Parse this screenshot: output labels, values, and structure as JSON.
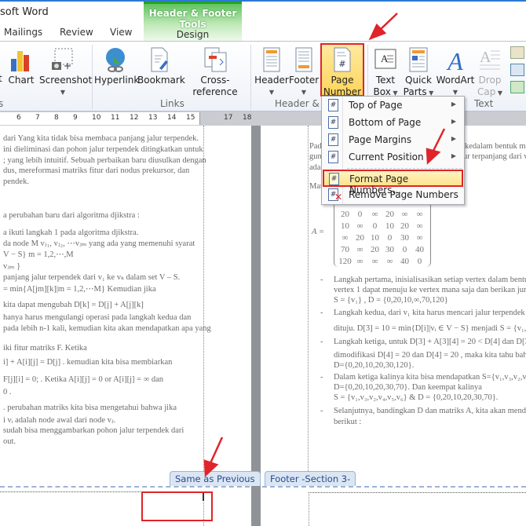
{
  "window": {
    "title": "soft Word"
  },
  "contextual_tab": {
    "group_label": "Header & Footer Tools",
    "tab": "Design",
    "color": "#5fc35f"
  },
  "tabs": [
    "Mailings",
    "Review",
    "View"
  ],
  "ribbon": {
    "buttons": [
      {
        "label": "Chart"
      },
      {
        "label": "Screenshot"
      },
      {
        "label": "Hyperlink"
      },
      {
        "label": "Bookmark"
      },
      {
        "label": "Cross-reference"
      },
      {
        "label": "Header"
      },
      {
        "label": "Footer"
      },
      {
        "label": "Page",
        "label2": "Number"
      },
      {
        "label": "Text",
        "label2": "Box"
      },
      {
        "label": "Quick",
        "label2": "Parts"
      },
      {
        "label": "WordArt"
      },
      {
        "label": "Drop",
        "label2": "Cap"
      }
    ],
    "groups": [
      "Links",
      "Header & F",
      "Text"
    ],
    "partial_left_label": "t",
    "partial_left_group": "s"
  },
  "ruler": [
    "6",
    "7",
    "8",
    "9",
    "10",
    "11",
    "12",
    "13",
    "14",
    "15",
    "17",
    "18"
  ],
  "page_number_menu": {
    "items": [
      {
        "label": "Top of Page",
        "submenu": true
      },
      {
        "label": "Bottom of Page",
        "submenu": true
      },
      {
        "label": "Page Margins",
        "submenu": true
      },
      {
        "label": "Current Position",
        "submenu": true
      },
      {
        "label": "Format Page Numbers...",
        "highlighted": true
      },
      {
        "label": "Remove Page Numbers"
      }
    ]
  },
  "left_page": {
    "lines": [
      "dari Yang kita tidak bisa membaca panjang jalur terpendek.",
      "ini dieliminasi dan pohon jalur terpendek ditingkatkan untuk",
      "; yang lebih intuitif. Sebuah perbaikan baru diusulkan dengan",
      "dus, mereformasi matriks fitur dari nodus prekursor, dan",
      "pendek.",
      "a perubahan baru dari algoritma djikstra :",
      "a ikuti langkah 1 pada algoritma djikstra.",
      "da node M vⱼ₁, vⱼ₂, ⋯vⱼₘ    yang ada yang memenuhi syarat",
      "V − S}  m = 1,2,⋯,M",
      "vⱼₘ }",
      "panjang jalur terpendek dari v₁ ke vₖ dalam set V – S.",
      "= min{A[jm][k]|m = 1,2,⋯M}  Kemudian jika",
      "kita dapat mengubah    D[k] = D[j] + A[j][k]",
      "hanya harus mengulangi operasi pada langkah kedua dan",
      "pada lebih n-1 kali, kemudian kita akan mendapatkan apa yang",
      "iki fitur matriks F. Ketika",
      "i] + A[i][j] = D[j] .  kemudian kita bisa membiarkan",
      "F[j][i] = 0; . Ketika  A[i][j] = 0   or   A[i][j] = ∞  dan",
      "0 .",
      ". perubahan matriks kita bisa mengetahui bahwa jika",
      "i vᵢ adalah node awal dari node vⱼ.",
      "sudah bisa menggambarkan pohon jalur terpendek dari",
      "out."
    ]
  },
  "right_page": {
    "intro": [
      "Pada",
      "guna",
      "ada.",
      "Mat"
    ],
    "intro_right": [
      "kedalam bentuk m",
      "ur terpanjang dari v"
    ],
    "matrix_label": "A =",
    "matrix": [
      [
        "0",
        "20",
        "10",
        "∞",
        "70",
        "120"
      ],
      [
        "20",
        "0",
        "∞",
        "20",
        "∞",
        "∞"
      ],
      [
        "10",
        "∞",
        "0",
        "10",
        "20",
        "∞"
      ],
      [
        "∞",
        "20",
        "10",
        "0",
        "30",
        "∞"
      ],
      [
        "70",
        "∞",
        "20",
        "30",
        "0",
        "40"
      ],
      [
        "120",
        "∞",
        "∞",
        "∞",
        "40",
        "0"
      ]
    ],
    "bullet": "-",
    "lines": [
      "Langkah pertama, inisialisasikan setiap vertex dalam bentuk",
      "vertex 1 dapat menuju ke vertex mana saja dan berikan juml",
      "S = {v₁} , D = {0,20,10,∞,70,120}",
      "Langkah kedua, dari v₁ kita harus mencari jalur terpendek da",
      "dituju. D[3] = 10 = min{D[i]|vᵢ ∈ V − S}   menjadi   S = {v₁, v₃}",
      "Langkah ketiga, untuk D[3] + A[3][4] = 20 < D[4]  dan  D[3] +",
      "dimodifikasi  D[4] = 20   dan   D[4] = 20 , maka kita tahu bah",
      "D={0,20,10,20,30,120}.",
      "Dalam ketiga kalinya kita bisa mendapatkan S={v₁,v₃,v₂,v₄,v",
      "D={0,20,10,20,30,70}. Dan keempat kalinya",
      "S = {v₁,v₃,v₂,v₄,v₅,v₆} & D = {0,20,10,20,30,70}.",
      "Selanjutnya, bandingkan D dan matriks A, kita akan mendap",
      "berikut :"
    ]
  },
  "footer_tabs": {
    "left": "Same as Previous",
    "right": "Footer -Section 3-"
  },
  "annotation_color": "#e0242a"
}
